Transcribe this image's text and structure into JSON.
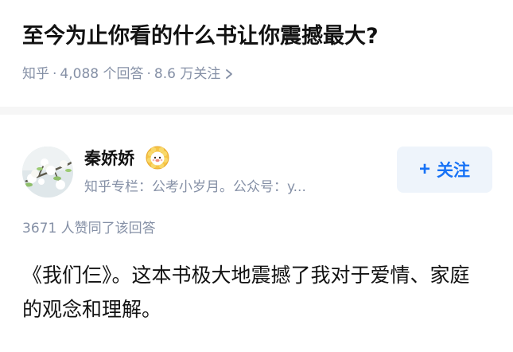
{
  "question": {
    "title": "至今为止你看的什么书让你震撼最大?",
    "source": "知乎",
    "separator": "·",
    "answer_count": "4,088 个回答",
    "follower_count": "8.6 万关注"
  },
  "author": {
    "name": "秦娇娇",
    "description": "知乎专栏：公考小岁月。公众号：y...",
    "badge_icon": "lion-badge-icon",
    "avatar_icon": "flower-branch-avatar"
  },
  "follow_button": {
    "plus": "+",
    "label": "关注"
  },
  "answer": {
    "votes": "3671 人赞同了该回答",
    "content": "《我们仨》。这本书极大地震撼了我对于爱情、家庭的观念和理解。"
  },
  "colors": {
    "accent": "#1772f6",
    "muted": "#8590a6",
    "text": "#121212",
    "follow_bg": "#eef4fb"
  }
}
